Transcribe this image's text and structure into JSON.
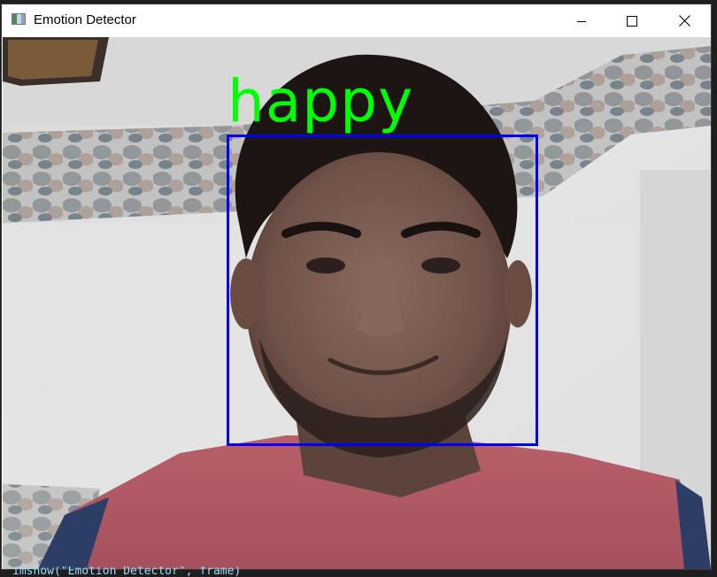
{
  "window": {
    "title": "Emotion Detector",
    "icon": "app-window-icon",
    "controls": {
      "minimize": "minimize-icon",
      "maximize": "maximize-icon",
      "close": "close-icon"
    }
  },
  "detection": {
    "emotion": "happy",
    "box_color": "#0000ff",
    "label_color": "#00ff00"
  },
  "console": {
    "partial_line": "imshow(\"Emotion Detector\", frame)"
  }
}
